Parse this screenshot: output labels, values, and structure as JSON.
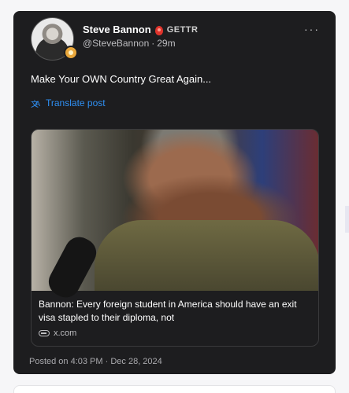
{
  "post": {
    "author_name": "Steve Bannon",
    "brand": "GETTR",
    "handle": "@SteveBannon",
    "separator": "·",
    "time_ago": "29m",
    "more_label": "···",
    "text": "Make Your OWN Country Great Again...",
    "translate_label": "Translate post",
    "link_card": {
      "caption": "Bannon: Every foreign student in America should have an exit visa stapled to their diploma, not",
      "domain": "x.com"
    },
    "posted": "Posted on 4:03 PM · Dec 28, 2024"
  },
  "icons": {
    "verified": "verified-flame-icon",
    "translate": "translate-icon",
    "link": "link-icon"
  },
  "colors": {
    "card_bg": "#1d1d1f",
    "link_blue": "#2f8ff2",
    "verified_red": "#e0342c"
  }
}
